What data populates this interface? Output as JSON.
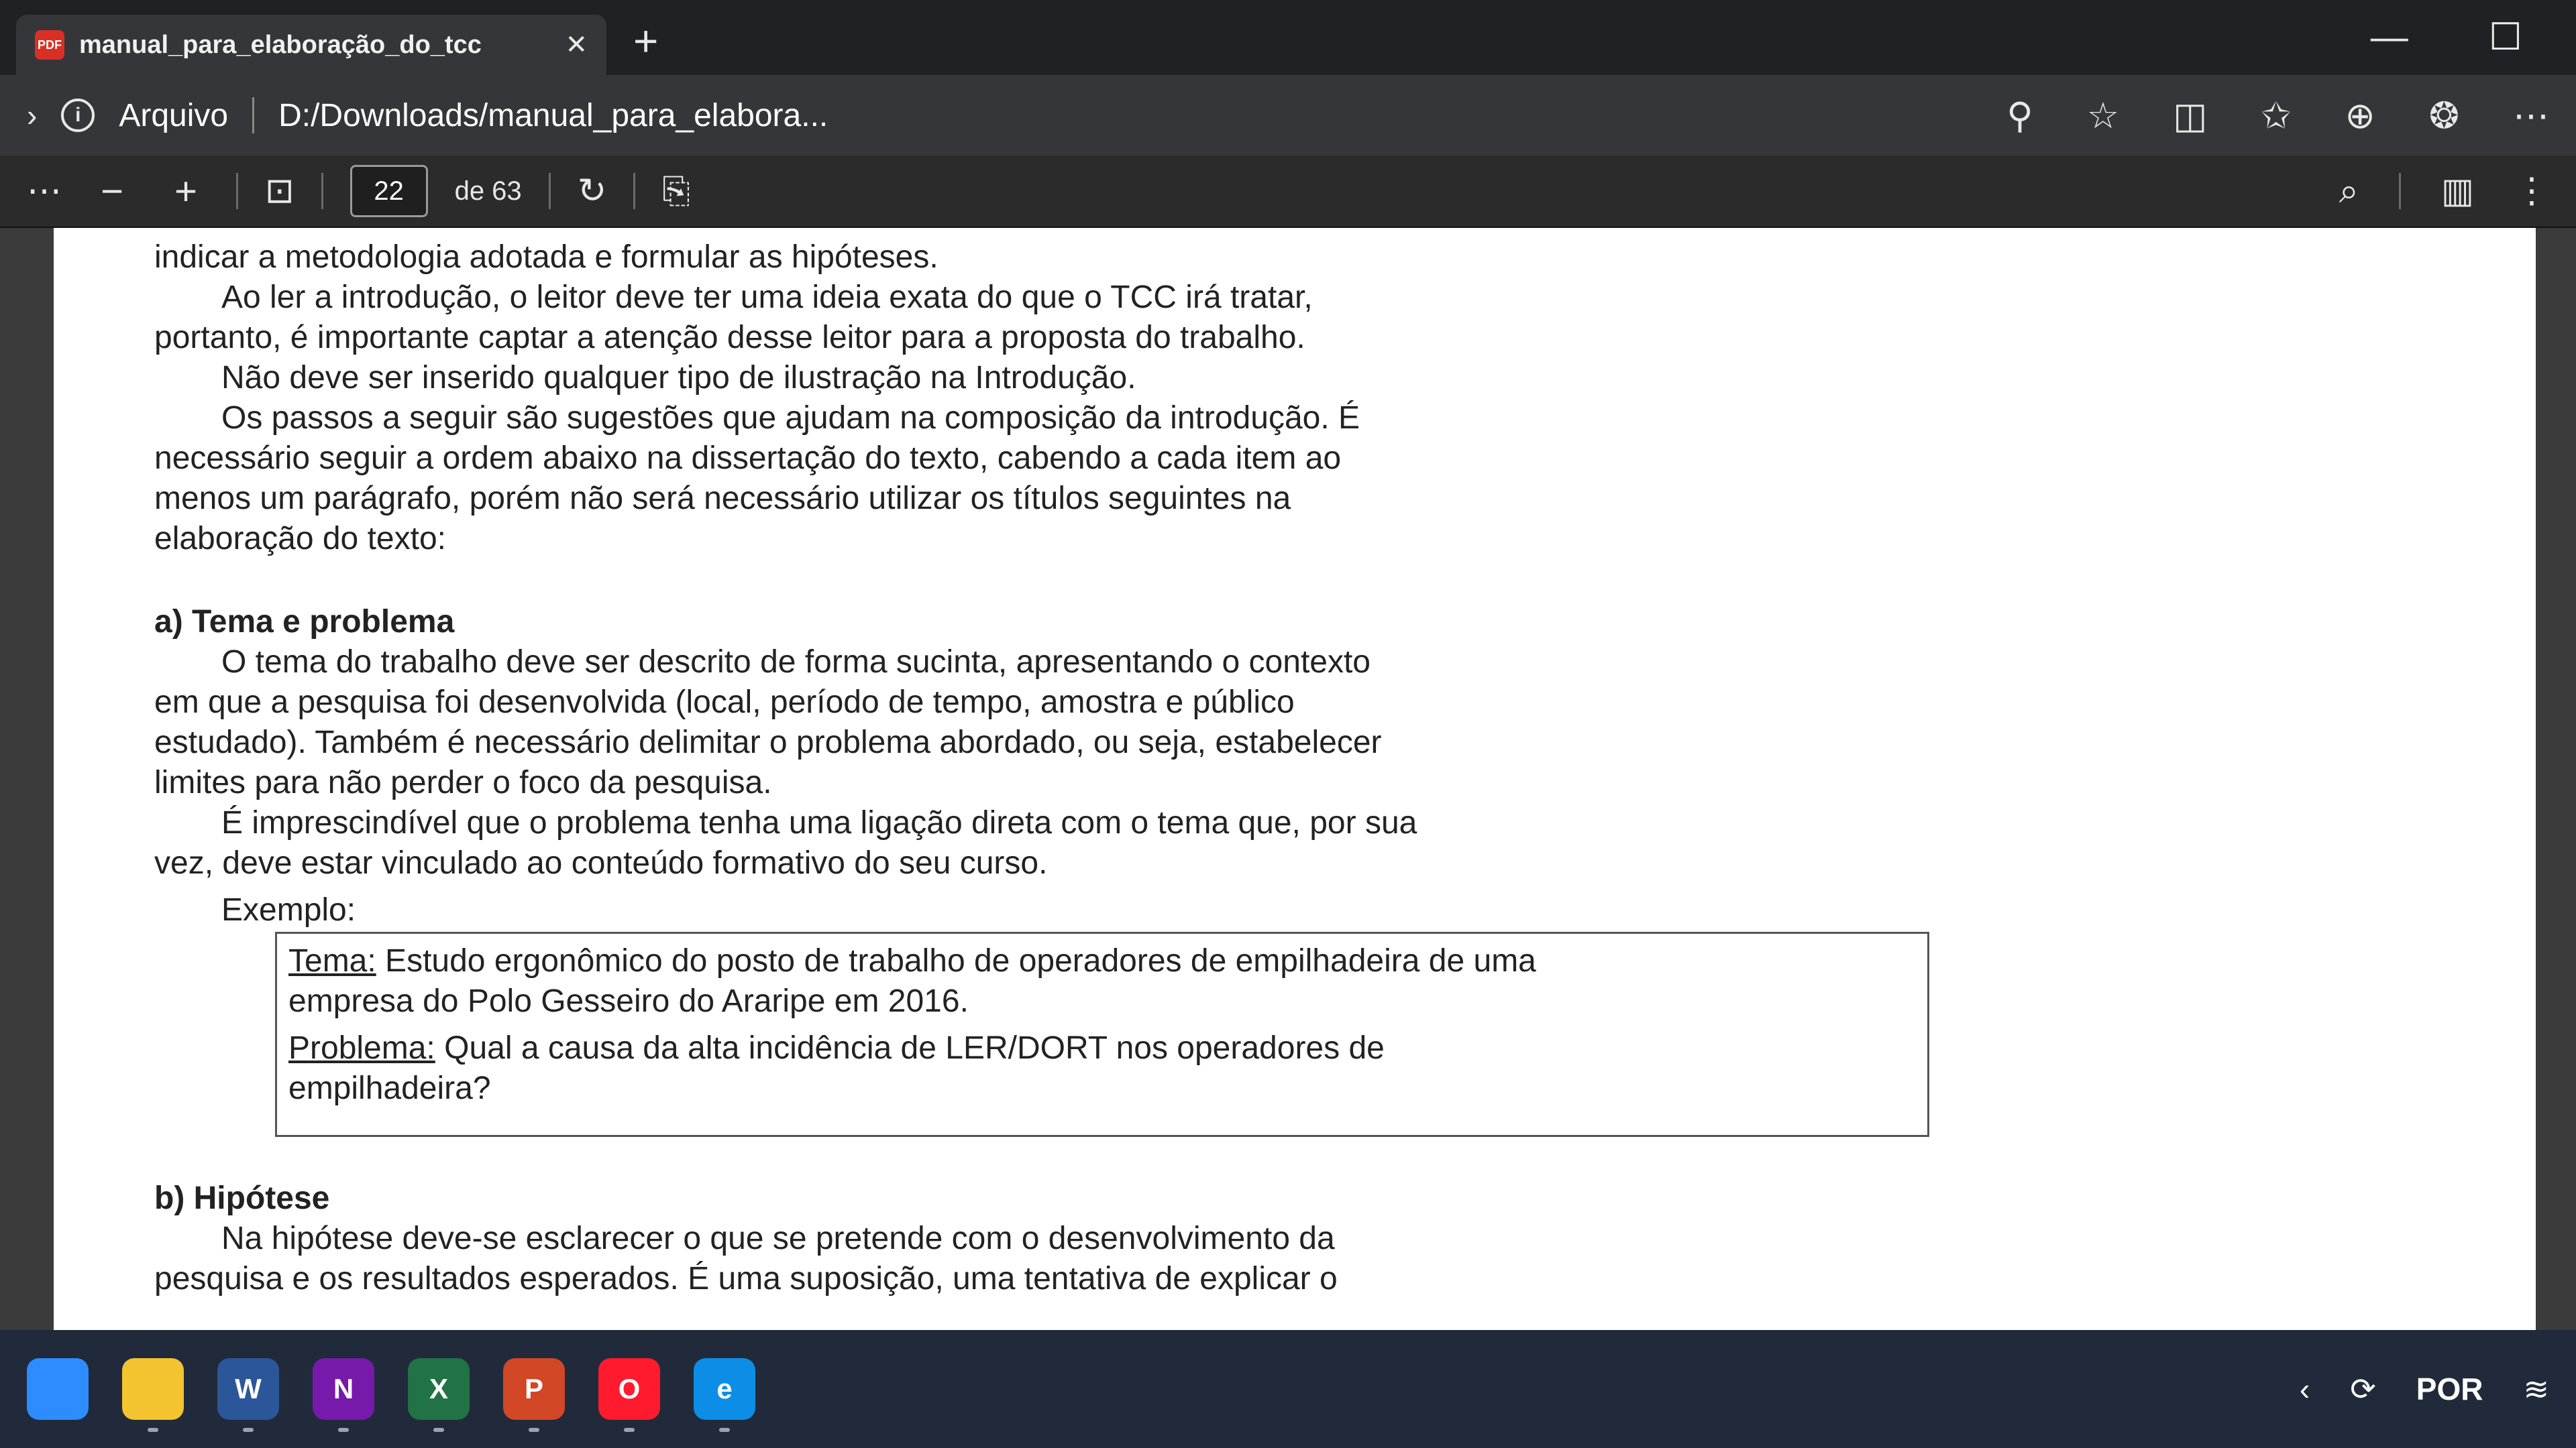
{
  "browser": {
    "tab_title": "manual_para_elaboração_do_tcc",
    "tab_close": "✕",
    "new_tab": "+",
    "scheme": "Arquivo",
    "url": "D:/Downloads/manual_para_elabora...",
    "min_label": "—",
    "max_label": "☐"
  },
  "pdf_toolbar": {
    "more": "⋯",
    "zoom_out": "−",
    "zoom_in": "+",
    "current_page": "22",
    "page_total": "de 63"
  },
  "document": {
    "lines": [
      "indicar a metodologia adotada e formular as hipóteses.",
      "Ao ler a introdução, o leitor deve ter uma ideia exata do que o TCC irá tratar,",
      "portanto, é importante captar a atenção desse leitor para a proposta do trabalho.",
      "Não deve ser inserido qualquer tipo de ilustração na Introdução.",
      "Os passos a seguir são sugestões que ajudam na composição da introdução. É",
      "necessário seguir a ordem abaixo na dissertação do texto, cabendo a cada item ao",
      "menos um parágrafo, porém não será necessário utilizar os títulos seguintes na",
      "elaboração do texto:"
    ],
    "section_a_title": "a)  Tema e problema",
    "section_a_lines": [
      "O tema do trabalho deve ser descrito de forma sucinta, apresentando o contexto",
      "em que a pesquisa foi desenvolvida (local, período de tempo, amostra e público",
      "estudado). Também é necessário delimitar o problema abordado, ou seja, estabelecer",
      "limites para não perder o foco da pesquisa.",
      "É imprescindível que o problema tenha uma ligação direta com o tema que, por sua",
      "vez, deve estar vinculado ao conteúdo formativo do seu curso."
    ],
    "example_label": "Exemplo:",
    "example": {
      "tema_label": "Tema:",
      "tema_text": " Estudo ergonômico do posto de trabalho de operadores de empilhadeira de uma",
      "tema_text2": "empresa do Polo Gesseiro do Araripe em 2016.",
      "problema_label": "Problema:",
      "problema_text": " Qual a causa da alta incidência de LER/DORT nos operadores de",
      "problema_text2": "empilhadeira?"
    },
    "section_b_title": "b)  Hipótese",
    "section_b_lines": [
      "Na hipótese deve-se esclarecer o que se pretende com o desenvolvimento da",
      "pesquisa e os resultados esperados. É uma suposição, uma tentativa de explicar o"
    ]
  },
  "taskbar": {
    "apps": [
      {
        "name": "zoom-app-icon",
        "label": "",
        "color": "#2d8cff"
      },
      {
        "name": "file-explorer-icon",
        "label": "",
        "color": "#f4c430"
      },
      {
        "name": "word-icon",
        "label": "W",
        "color": "#2b579a"
      },
      {
        "name": "onenote-icon",
        "label": "N",
        "color": "#7719aa"
      },
      {
        "name": "excel-icon",
        "label": "X",
        "color": "#217346"
      },
      {
        "name": "powerpoint-icon",
        "label": "P",
        "color": "#d24726"
      },
      {
        "name": "opera-icon",
        "label": "O",
        "color": "#ff1b2d"
      },
      {
        "name": "edge-icon",
        "label": "e",
        "color": "#0c8ee6"
      }
    ],
    "language": "POR",
    "chevron": "‹"
  }
}
